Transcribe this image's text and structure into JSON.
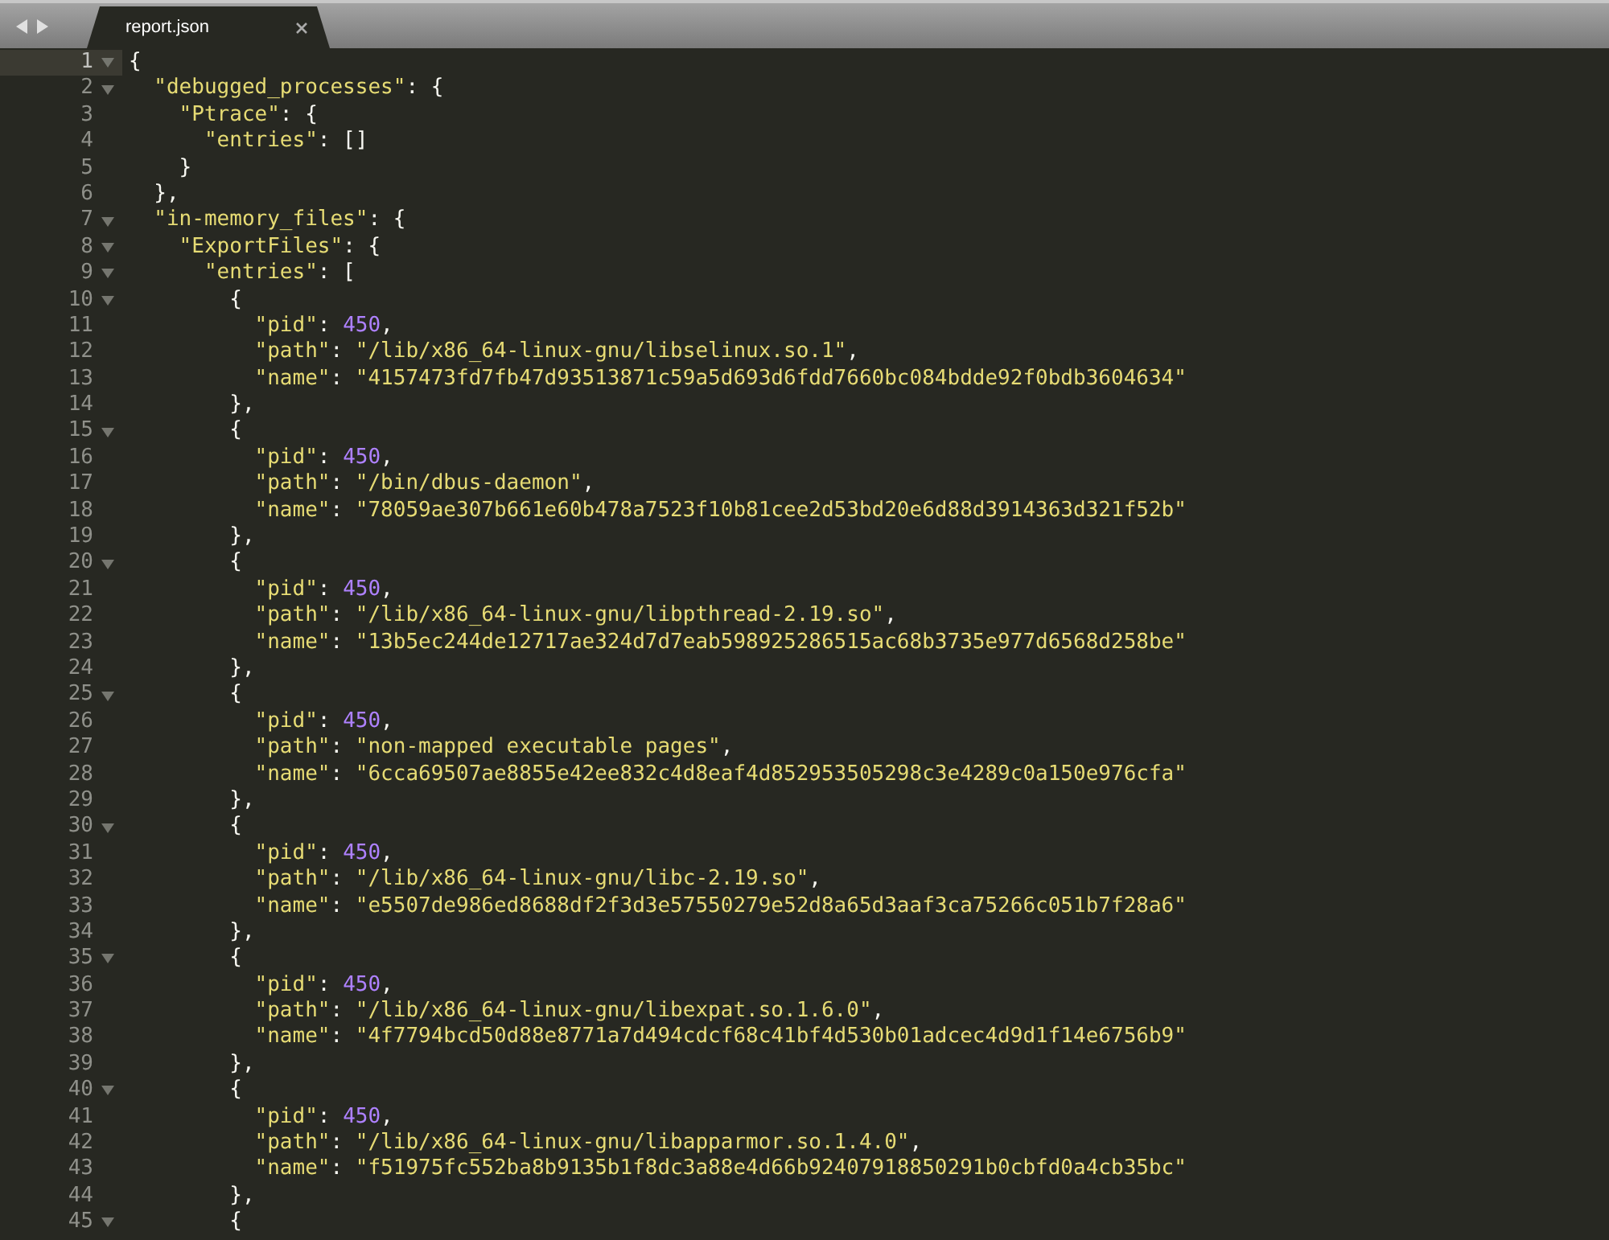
{
  "tab_bar": {
    "tabs": [
      {
        "label": "report.json",
        "selected": true
      }
    ]
  },
  "lines": [
    {
      "number": "1",
      "foldable": true,
      "current": true,
      "tokens": [
        {
          "kind": "punct",
          "text": "{"
        }
      ]
    },
    {
      "number": "2",
      "foldable": true,
      "current": false,
      "tokens": [
        {
          "kind": "string",
          "text": "  \"debugged_processes\""
        },
        {
          "kind": "punct",
          "text": ": {"
        }
      ]
    },
    {
      "number": "3",
      "foldable": false,
      "current": false,
      "tokens": [
        {
          "kind": "string",
          "text": "    \"Ptrace\""
        },
        {
          "kind": "punct",
          "text": ": {"
        }
      ]
    },
    {
      "number": "4",
      "foldable": false,
      "current": false,
      "tokens": [
        {
          "kind": "string",
          "text": "      \"entries\""
        },
        {
          "kind": "punct",
          "text": ": []"
        }
      ]
    },
    {
      "number": "5",
      "foldable": false,
      "current": false,
      "tokens": [
        {
          "kind": "punct",
          "text": "    }"
        }
      ]
    },
    {
      "number": "6",
      "foldable": false,
      "current": false,
      "tokens": [
        {
          "kind": "punct",
          "text": "  },"
        }
      ]
    },
    {
      "number": "7",
      "foldable": true,
      "current": false,
      "tokens": [
        {
          "kind": "string",
          "text": "  \"in-memory_files\""
        },
        {
          "kind": "punct",
          "text": ": {"
        }
      ]
    },
    {
      "number": "8",
      "foldable": true,
      "current": false,
      "tokens": [
        {
          "kind": "string",
          "text": "    \"ExportFiles\""
        },
        {
          "kind": "punct",
          "text": ": {"
        }
      ]
    },
    {
      "number": "9",
      "foldable": true,
      "current": false,
      "tokens": [
        {
          "kind": "string",
          "text": "      \"entries\""
        },
        {
          "kind": "punct",
          "text": ": ["
        }
      ]
    },
    {
      "number": "10",
      "foldable": true,
      "current": false,
      "tokens": [
        {
          "kind": "punct",
          "text": "        {"
        }
      ]
    },
    {
      "number": "11",
      "foldable": false,
      "current": false,
      "tokens": [
        {
          "kind": "string",
          "text": "          \"pid\""
        },
        {
          "kind": "punct",
          "text": ": "
        },
        {
          "kind": "number",
          "text": "450"
        },
        {
          "kind": "punct",
          "text": ","
        }
      ]
    },
    {
      "number": "12",
      "foldable": false,
      "current": false,
      "tokens": [
        {
          "kind": "string",
          "text": "          \"path\""
        },
        {
          "kind": "punct",
          "text": ": "
        },
        {
          "kind": "string",
          "text": "\"/lib/x86_64-linux-gnu/libselinux.so.1\""
        },
        {
          "kind": "punct",
          "text": ","
        }
      ]
    },
    {
      "number": "13",
      "foldable": false,
      "current": false,
      "tokens": [
        {
          "kind": "string",
          "text": "          \"name\""
        },
        {
          "kind": "punct",
          "text": ": "
        },
        {
          "kind": "string",
          "text": "\"4157473fd7fb47d93513871c59a5d693d6fdd7660bc084bdde92f0bdb3604634\""
        }
      ]
    },
    {
      "number": "14",
      "foldable": false,
      "current": false,
      "tokens": [
        {
          "kind": "punct",
          "text": "        },"
        }
      ]
    },
    {
      "number": "15",
      "foldable": true,
      "current": false,
      "tokens": [
        {
          "kind": "punct",
          "text": "        {"
        }
      ]
    },
    {
      "number": "16",
      "foldable": false,
      "current": false,
      "tokens": [
        {
          "kind": "string",
          "text": "          \"pid\""
        },
        {
          "kind": "punct",
          "text": ": "
        },
        {
          "kind": "number",
          "text": "450"
        },
        {
          "kind": "punct",
          "text": ","
        }
      ]
    },
    {
      "number": "17",
      "foldable": false,
      "current": false,
      "tokens": [
        {
          "kind": "string",
          "text": "          \"path\""
        },
        {
          "kind": "punct",
          "text": ": "
        },
        {
          "kind": "string",
          "text": "\"/bin/dbus-daemon\""
        },
        {
          "kind": "punct",
          "text": ","
        }
      ]
    },
    {
      "number": "18",
      "foldable": false,
      "current": false,
      "tokens": [
        {
          "kind": "string",
          "text": "          \"name\""
        },
        {
          "kind": "punct",
          "text": ": "
        },
        {
          "kind": "string",
          "text": "\"78059ae307b661e60b478a7523f10b81cee2d53bd20e6d88d3914363d321f52b\""
        }
      ]
    },
    {
      "number": "19",
      "foldable": false,
      "current": false,
      "tokens": [
        {
          "kind": "punct",
          "text": "        },"
        }
      ]
    },
    {
      "number": "20",
      "foldable": true,
      "current": false,
      "tokens": [
        {
          "kind": "punct",
          "text": "        {"
        }
      ]
    },
    {
      "number": "21",
      "foldable": false,
      "current": false,
      "tokens": [
        {
          "kind": "string",
          "text": "          \"pid\""
        },
        {
          "kind": "punct",
          "text": ": "
        },
        {
          "kind": "number",
          "text": "450"
        },
        {
          "kind": "punct",
          "text": ","
        }
      ]
    },
    {
      "number": "22",
      "foldable": false,
      "current": false,
      "tokens": [
        {
          "kind": "string",
          "text": "          \"path\""
        },
        {
          "kind": "punct",
          "text": ": "
        },
        {
          "kind": "string",
          "text": "\"/lib/x86_64-linux-gnu/libpthread-2.19.so\""
        },
        {
          "kind": "punct",
          "text": ","
        }
      ]
    },
    {
      "number": "23",
      "foldable": false,
      "current": false,
      "tokens": [
        {
          "kind": "string",
          "text": "          \"name\""
        },
        {
          "kind": "punct",
          "text": ": "
        },
        {
          "kind": "string",
          "text": "\"13b5ec244de12717ae324d7d7eab598925286515ac68b3735e977d6568d258be\""
        }
      ]
    },
    {
      "number": "24",
      "foldable": false,
      "current": false,
      "tokens": [
        {
          "kind": "punct",
          "text": "        },"
        }
      ]
    },
    {
      "number": "25",
      "foldable": true,
      "current": false,
      "tokens": [
        {
          "kind": "punct",
          "text": "        {"
        }
      ]
    },
    {
      "number": "26",
      "foldable": false,
      "current": false,
      "tokens": [
        {
          "kind": "string",
          "text": "          \"pid\""
        },
        {
          "kind": "punct",
          "text": ": "
        },
        {
          "kind": "number",
          "text": "450"
        },
        {
          "kind": "punct",
          "text": ","
        }
      ]
    },
    {
      "number": "27",
      "foldable": false,
      "current": false,
      "tokens": [
        {
          "kind": "string",
          "text": "          \"path\""
        },
        {
          "kind": "punct",
          "text": ": "
        },
        {
          "kind": "string",
          "text": "\"non-mapped executable pages\""
        },
        {
          "kind": "punct",
          "text": ","
        }
      ]
    },
    {
      "number": "28",
      "foldable": false,
      "current": false,
      "tokens": [
        {
          "kind": "string",
          "text": "          \"name\""
        },
        {
          "kind": "punct",
          "text": ": "
        },
        {
          "kind": "string",
          "text": "\"6cca69507ae8855e42ee832c4d8eaf4d852953505298c3e4289c0a150e976cfa\""
        }
      ]
    },
    {
      "number": "29",
      "foldable": false,
      "current": false,
      "tokens": [
        {
          "kind": "punct",
          "text": "        },"
        }
      ]
    },
    {
      "number": "30",
      "foldable": true,
      "current": false,
      "tokens": [
        {
          "kind": "punct",
          "text": "        {"
        }
      ]
    },
    {
      "number": "31",
      "foldable": false,
      "current": false,
      "tokens": [
        {
          "kind": "string",
          "text": "          \"pid\""
        },
        {
          "kind": "punct",
          "text": ": "
        },
        {
          "kind": "number",
          "text": "450"
        },
        {
          "kind": "punct",
          "text": ","
        }
      ]
    },
    {
      "number": "32",
      "foldable": false,
      "current": false,
      "tokens": [
        {
          "kind": "string",
          "text": "          \"path\""
        },
        {
          "kind": "punct",
          "text": ": "
        },
        {
          "kind": "string",
          "text": "\"/lib/x86_64-linux-gnu/libc-2.19.so\""
        },
        {
          "kind": "punct",
          "text": ","
        }
      ]
    },
    {
      "number": "33",
      "foldable": false,
      "current": false,
      "tokens": [
        {
          "kind": "string",
          "text": "          \"name\""
        },
        {
          "kind": "punct",
          "text": ": "
        },
        {
          "kind": "string",
          "text": "\"e5507de986ed8688df2f3d3e57550279e52d8a65d3aaf3ca75266c051b7f28a6\""
        }
      ]
    },
    {
      "number": "34",
      "foldable": false,
      "current": false,
      "tokens": [
        {
          "kind": "punct",
          "text": "        },"
        }
      ]
    },
    {
      "number": "35",
      "foldable": true,
      "current": false,
      "tokens": [
        {
          "kind": "punct",
          "text": "        {"
        }
      ]
    },
    {
      "number": "36",
      "foldable": false,
      "current": false,
      "tokens": [
        {
          "kind": "string",
          "text": "          \"pid\""
        },
        {
          "kind": "punct",
          "text": ": "
        },
        {
          "kind": "number",
          "text": "450"
        },
        {
          "kind": "punct",
          "text": ","
        }
      ]
    },
    {
      "number": "37",
      "foldable": false,
      "current": false,
      "tokens": [
        {
          "kind": "string",
          "text": "          \"path\""
        },
        {
          "kind": "punct",
          "text": ": "
        },
        {
          "kind": "string",
          "text": "\"/lib/x86_64-linux-gnu/libexpat.so.1.6.0\""
        },
        {
          "kind": "punct",
          "text": ","
        }
      ]
    },
    {
      "number": "38",
      "foldable": false,
      "current": false,
      "tokens": [
        {
          "kind": "string",
          "text": "          \"name\""
        },
        {
          "kind": "punct",
          "text": ": "
        },
        {
          "kind": "string",
          "text": "\"4f7794bcd50d88e8771a7d494cdcf68c41bf4d530b01adcec4d9d1f14e6756b9\""
        }
      ]
    },
    {
      "number": "39",
      "foldable": false,
      "current": false,
      "tokens": [
        {
          "kind": "punct",
          "text": "        },"
        }
      ]
    },
    {
      "number": "40",
      "foldable": true,
      "current": false,
      "tokens": [
        {
          "kind": "punct",
          "text": "        {"
        }
      ]
    },
    {
      "number": "41",
      "foldable": false,
      "current": false,
      "tokens": [
        {
          "kind": "string",
          "text": "          \"pid\""
        },
        {
          "kind": "punct",
          "text": ": "
        },
        {
          "kind": "number",
          "text": "450"
        },
        {
          "kind": "punct",
          "text": ","
        }
      ]
    },
    {
      "number": "42",
      "foldable": false,
      "current": false,
      "tokens": [
        {
          "kind": "string",
          "text": "          \"path\""
        },
        {
          "kind": "punct",
          "text": ": "
        },
        {
          "kind": "string",
          "text": "\"/lib/x86_64-linux-gnu/libapparmor.so.1.4.0\""
        },
        {
          "kind": "punct",
          "text": ","
        }
      ]
    },
    {
      "number": "43",
      "foldable": false,
      "current": false,
      "tokens": [
        {
          "kind": "string",
          "text": "          \"name\""
        },
        {
          "kind": "punct",
          "text": ": "
        },
        {
          "kind": "string",
          "text": "\"f51975fc552ba8b9135b1f8dc3a88e4d66b92407918850291b0cbfd0a4cb35bc\""
        }
      ]
    },
    {
      "number": "44",
      "foldable": false,
      "current": false,
      "tokens": [
        {
          "kind": "punct",
          "text": "        },"
        }
      ]
    },
    {
      "number": "45",
      "foldable": true,
      "current": false,
      "tokens": [
        {
          "kind": "punct",
          "text": "        {"
        }
      ]
    }
  ]
}
